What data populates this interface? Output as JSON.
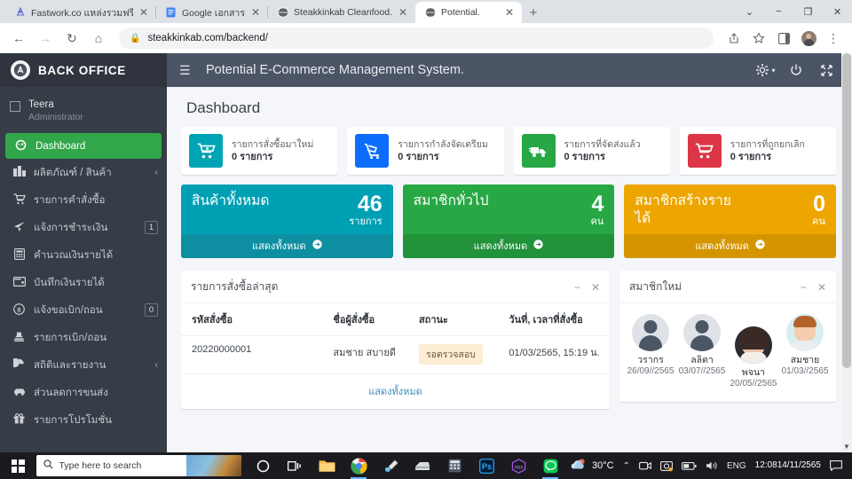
{
  "browser": {
    "tabs": [
      {
        "title": "Fastwork.co แหล่งรวมฟรีแลนซ์คุณภ",
        "favicon": "fastwork-icon",
        "active": false
      },
      {
        "title": "Google เอกสาร",
        "favicon": "google-docs-icon",
        "active": false
      },
      {
        "title": "Steakkinkab Cleanfood.",
        "favicon": "globe-icon",
        "active": false
      },
      {
        "title": "Potential.",
        "favicon": "globe-icon",
        "active": true
      }
    ],
    "new_tab_label": "+",
    "window_controls": {
      "minimize": "−",
      "maximize": "❐",
      "close": "✕",
      "tab_search": "⌄"
    },
    "nav": {
      "back": "←",
      "forward": "→",
      "reload": "↻",
      "home": "⌂"
    },
    "address": "steakkinkab.com/backend/",
    "lock": "lock-icon",
    "toolbar_right": {
      "share": "share-icon",
      "bookmark": "star-icon",
      "sidepanel": "side-panel-icon",
      "profile": "profile-avatar",
      "menu": "⋮"
    }
  },
  "sidebar": {
    "brand": {
      "logo_letter": "Ⓐ",
      "text": "BACK OFFICE"
    },
    "user": {
      "name": "Teera",
      "role": "Administrator"
    },
    "items": [
      {
        "label": "Dashboard",
        "icon": "dashboard-icon",
        "active": true,
        "badge": null,
        "chevron": null
      },
      {
        "label": "ผลิตภัณฑ์ / สินค้า",
        "icon": "products-icon",
        "active": false,
        "badge": null,
        "chevron": "‹"
      },
      {
        "label": "รายการคำสั่งซื้อ",
        "icon": "cart-icon",
        "active": false,
        "badge": null,
        "chevron": null
      },
      {
        "label": "แจ้งการชำระเงิน",
        "icon": "send-icon",
        "active": false,
        "badge": "1",
        "chevron": null
      },
      {
        "label": "คำนวณเงินรายได้",
        "icon": "calculator-icon",
        "active": false,
        "badge": null,
        "chevron": null
      },
      {
        "label": "บันทึกเงินรายได้",
        "icon": "wallet-icon",
        "active": false,
        "badge": null,
        "chevron": null
      },
      {
        "label": "แจ้งขอเบิก/ถอน",
        "icon": "baht-circle-icon",
        "active": false,
        "badge": "0",
        "chevron": null
      },
      {
        "label": "รายการเบิก/ถอน",
        "icon": "stamp-icon",
        "active": false,
        "badge": null,
        "chevron": null
      },
      {
        "label": "สถิติและรายงาน",
        "icon": "pie-chart-icon",
        "active": false,
        "badge": null,
        "chevron": "‹"
      },
      {
        "label": "ส่วนลดการขนส่ง",
        "icon": "car-icon",
        "active": false,
        "badge": null,
        "chevron": null
      },
      {
        "label": "รายการโปรโมชั่น",
        "icon": "gift-icon",
        "active": false,
        "badge": null,
        "chevron": null
      }
    ]
  },
  "topbar": {
    "menu_toggle": "hamburger-icon",
    "title": "Potential E-Commerce Management System.",
    "settings_icon": "gear-icon",
    "settings_caret": "▾",
    "power_icon": "power-icon",
    "fullscreen_icon": "fullscreen-icon"
  },
  "page": {
    "title": "Dashboard",
    "small_cards": [
      {
        "label": "รายการสั่งซื้อมาใหม่",
        "value": "0 รายการ",
        "icon": "cart-plus-icon",
        "color": "#00a5b5"
      },
      {
        "label": "รายการกำลังจัดเตรียม",
        "value": "0 รายการ",
        "icon": "hand-truck-icon",
        "color": "#0d6efd"
      },
      {
        "label": "รายการที่จัดส่งแล้ว",
        "value": "0 รายการ",
        "icon": "shipping-truck-icon",
        "color": "#28a745"
      },
      {
        "label": "รายการที่ถูกยกเลิก",
        "value": "0 รายการ",
        "icon": "cart-cancel-icon",
        "color": "#dc3545"
      }
    ],
    "big_boxes": [
      {
        "title": "สินค้าทั้งหมด",
        "value": "46",
        "unit": "รายการ",
        "footer": "แสดงทั้งหมด",
        "color": "#00a0b4",
        "footer_color": "#0d8fa1"
      },
      {
        "title": "สมาชิกทั่วไป",
        "value": "4",
        "unit": "คน",
        "footer": "แสดงทั้งหมด",
        "color": "#27a844",
        "footer_color": "#21913a"
      },
      {
        "title": "สมาชิกสร้างรายได้",
        "value": "0",
        "unit": "คน",
        "footer": "แสดงทั้งหมด",
        "color": "#eda600",
        "footer_color": "#d49500"
      }
    ],
    "orders_panel": {
      "title": "รายการสั่งซื้อล่าสุด",
      "minimize": "−",
      "close": "✕",
      "columns": [
        "รหัสสั่งซื้อ",
        "ชื่อผู้สั่งซื้อ",
        "สถานะ",
        "วันที่, เวลาที่สั่งซื้อ"
      ],
      "rows": [
        {
          "code": "20220000001",
          "buyer": "สมชาย สบายดี",
          "status": "รอตรวจสอบ",
          "datetime": "01/03/2565, 15:19 น."
        }
      ],
      "show_all": "แสดงทั้งหมด"
    },
    "members_panel": {
      "title": "สมาชิกใหม่",
      "minimize": "−",
      "close": "✕",
      "members": [
        {
          "name": "วรากร",
          "date": "26/09//2565",
          "avatar": "default-avatar"
        },
        {
          "name": "ลลิตา",
          "date": "03/07//2565",
          "avatar": "default-avatar"
        },
        {
          "name": "พจนา",
          "date": "20/05//2565",
          "avatar": "photo-avatar"
        },
        {
          "name": "สมชาย",
          "date": "01/03//2565",
          "avatar": "cartoon-avatar"
        }
      ]
    }
  },
  "taskbar": {
    "start": "windows-start-icon",
    "search_placeholder": "Type here to search",
    "search_icon": "search-icon",
    "icons": [
      {
        "name": "cortana-icon"
      },
      {
        "name": "task-view-icon"
      },
      {
        "name": "file-explorer-icon"
      },
      {
        "name": "chrome-icon"
      },
      {
        "name": "paint-icon"
      },
      {
        "name": "scanner-icon"
      },
      {
        "name": "calculator-icon"
      },
      {
        "name": "photoshop-icon"
      },
      {
        "name": "nox-icon"
      },
      {
        "name": "line-icon"
      }
    ],
    "weather": {
      "icon": "weather-cloud-sun-icon",
      "temp": "30°C"
    },
    "tray": {
      "expand": "⌃",
      "camera": "camera-icon",
      "screenshot": "screenshot-icon",
      "battery": "battery-icon",
      "volume": "volume-icon",
      "language": "ENG"
    },
    "clock": {
      "time": "12:08",
      "date": "14/11/2565"
    },
    "notifications": "notification-icon"
  }
}
